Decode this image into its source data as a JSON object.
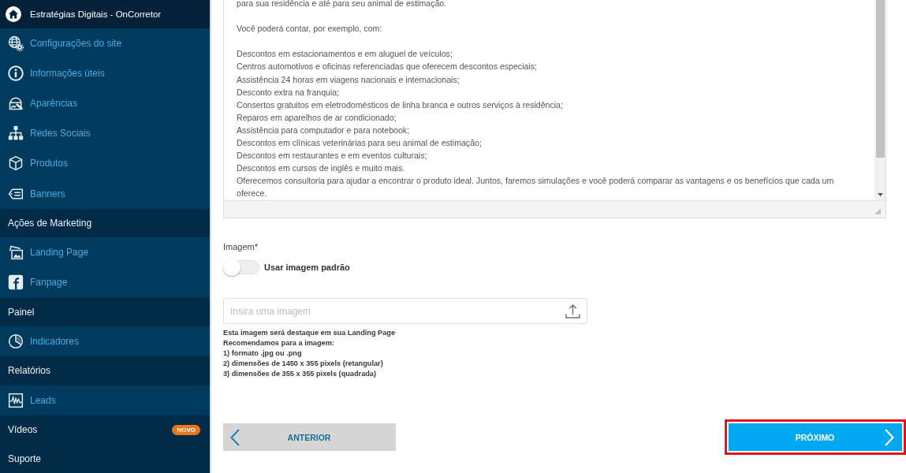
{
  "sidebar": {
    "title": "Estratégias Digitais - OnCorretor",
    "entries": [
      {
        "kind": "link",
        "label": "Configurações do site"
      },
      {
        "kind": "link",
        "label": "Informações úteis"
      },
      {
        "kind": "link",
        "label": "Aparências"
      },
      {
        "kind": "link",
        "label": "Redes Sociais"
      },
      {
        "kind": "link",
        "label": "Produtos"
      },
      {
        "kind": "link",
        "label": "Banners"
      },
      {
        "kind": "section",
        "label": "Ações de Marketing"
      },
      {
        "kind": "link",
        "label": "Landing Page"
      },
      {
        "kind": "link",
        "label": "Fanpage"
      },
      {
        "kind": "section",
        "label": "Painel"
      },
      {
        "kind": "link",
        "label": "Indicadores"
      },
      {
        "kind": "section",
        "label": "Relatórios"
      },
      {
        "kind": "link",
        "label": "Leads"
      },
      {
        "kind": "section",
        "label": "Vídeos",
        "badge": "NOVO"
      },
      {
        "kind": "section",
        "label": "Suporte"
      }
    ]
  },
  "description": {
    "paragraphs": [
      [
        "para sua residência e até para seu animal de estimação."
      ],
      [
        "Você poderá contar, por exemplo, com:"
      ],
      [
        "Descontos em estacionamentos e em aluguel de veículos;",
        "Centros automotivos e oficinas referenciadas que oferecem descontos especiais;",
        "Assistência 24 horas em viagens nacionais e internacionais;",
        "Desconto extra na franquia;",
        "Consertos gratuitos em eletrodomésticos de linha branca e outros serviços à residência;",
        "Reparos em aparelhos de ar condicionado;",
        "Assistência para computador e para notebook;",
        "Descontos em clínicas veterinárias para seu animal de estimação;",
        "Descontos em restaurantes e em eventos culturais;",
        "Descontos em cursos de inglês e muito mais.",
        "Oferecemos consultoria para ajudar a encontrar o produto ideal. Juntos, faremos simulações e você poderá comparar as vantagens e os benefícios que cada um oferece."
      ]
    ]
  },
  "image": {
    "label": "Imagem*",
    "toggle": {
      "label": "Usar imagem padrão",
      "on": false
    },
    "upload": {
      "placeholder": "Insira uma imagem"
    },
    "help": [
      "Esta imagem será destaque em sua Landing Page",
      "Recomendamos para a imagem:",
      "1) formato .jpg ou .png",
      "2) dimensões de 1450 x 355 pixels (retangular)",
      "3) dimensões de 355 x 355 pixels (quadrada)"
    ]
  },
  "buttons": [
    {
      "kind": "back",
      "label": "ANTERIOR",
      "highlighted": false
    },
    {
      "kind": "next",
      "label": "PRÓXIMO",
      "highlighted": true
    }
  ]
}
